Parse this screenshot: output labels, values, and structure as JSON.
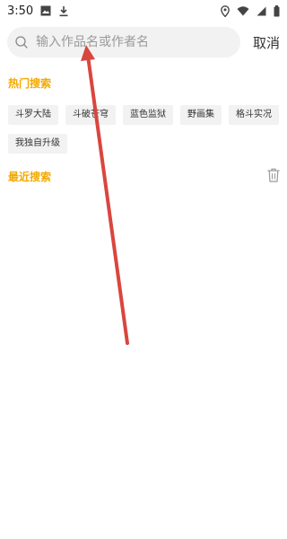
{
  "status_bar": {
    "time": "3:50",
    "icons": [
      "image-icon",
      "download-icon",
      "location-icon",
      "wifi-icon",
      "signal-icon",
      "battery-icon"
    ]
  },
  "search": {
    "placeholder": "输入作品名或作者名",
    "value": "",
    "cancel_label": "取消"
  },
  "hot_search": {
    "title": "热门搜索",
    "tags": [
      "斗罗大陆",
      "斗破苍穹",
      "蓝色监狱",
      "野画集",
      "格斗实况",
      "我独自升级"
    ]
  },
  "recent_search": {
    "title": "最近搜索",
    "icon": "trash-icon"
  },
  "colors": {
    "accent": "#f2a900",
    "annotation_arrow": "#d9463f",
    "tag_background": "#f2f2f2"
  }
}
